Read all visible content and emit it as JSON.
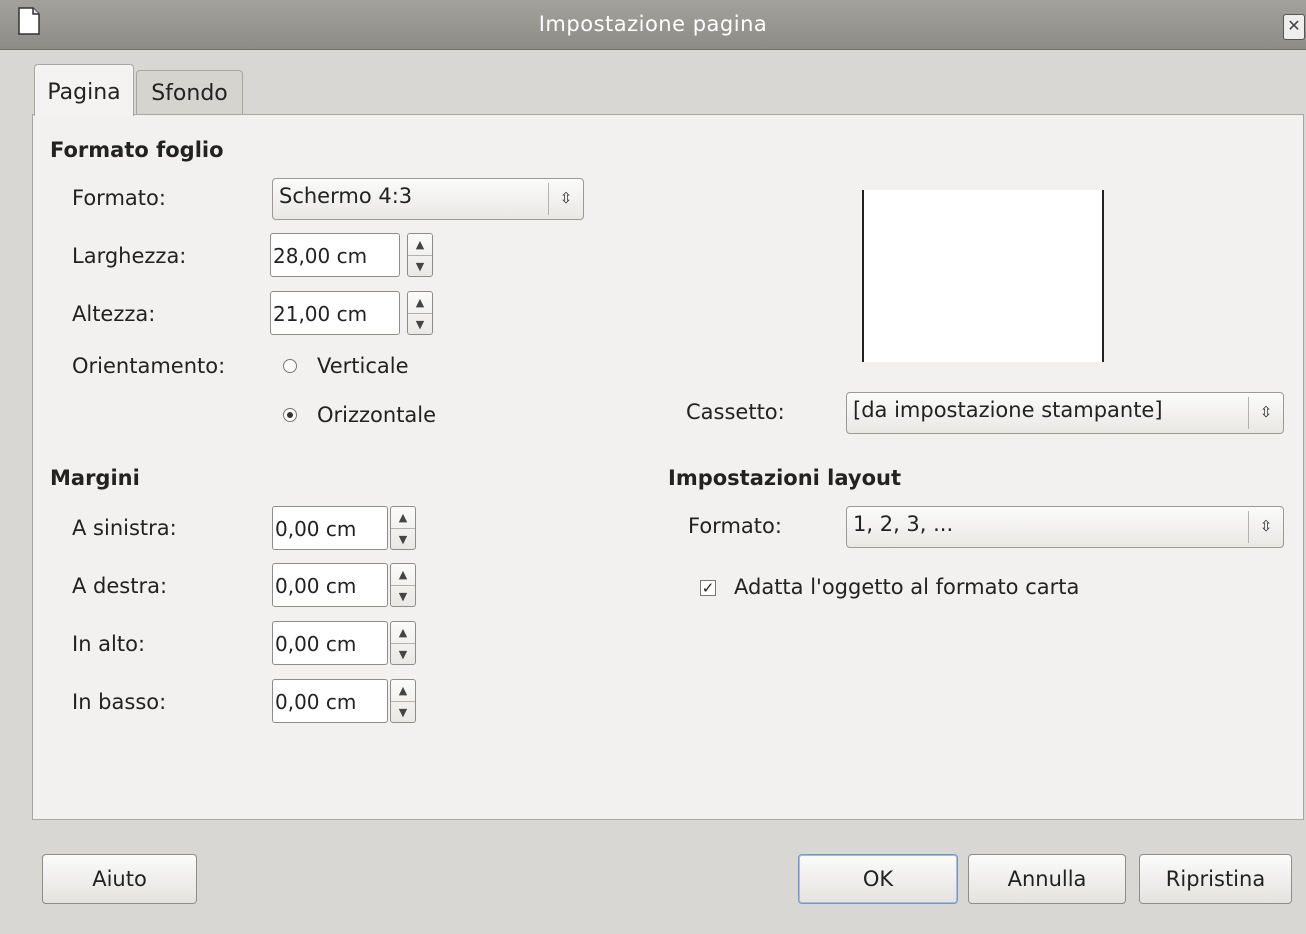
{
  "window": {
    "title": "Impostazione pagina"
  },
  "tabs": [
    {
      "label": "Pagina",
      "active": true
    },
    {
      "label": "Sfondo",
      "active": false
    }
  ],
  "paper_format": {
    "title": "Formato foglio",
    "format_label": "Formato:",
    "format_value": "Schermo 4:3",
    "width_label": "Larghezza:",
    "width_value": "28,00 cm",
    "height_label": "Altezza:",
    "height_value": "21,00 cm",
    "orientation_label": "Orientamento:",
    "portrait_label": "Verticale",
    "landscape_label": "Orizzontale",
    "orientation_selected": "Orizzontale",
    "tray_label": "Cassetto:",
    "tray_value": "[da impostazione stampante]"
  },
  "margins": {
    "title": "Margini",
    "left_label": "A sinistra:",
    "left_value": "0,00 cm",
    "right_label": "A destra:",
    "right_value": "0,00 cm",
    "top_label": "In alto:",
    "top_value": "0,00 cm",
    "bottom_label": "In basso:",
    "bottom_value": "0,00 cm"
  },
  "layout_settings": {
    "title": "Impostazioni layout",
    "format_label": "Formato:",
    "format_value": "1, 2, 3, ...",
    "fit_label": "Adatta l'oggetto al formato carta",
    "fit_checked": true
  },
  "buttons": {
    "help": "Aiuto",
    "ok": "OK",
    "cancel": "Annulla",
    "reset": "Ripristina"
  }
}
